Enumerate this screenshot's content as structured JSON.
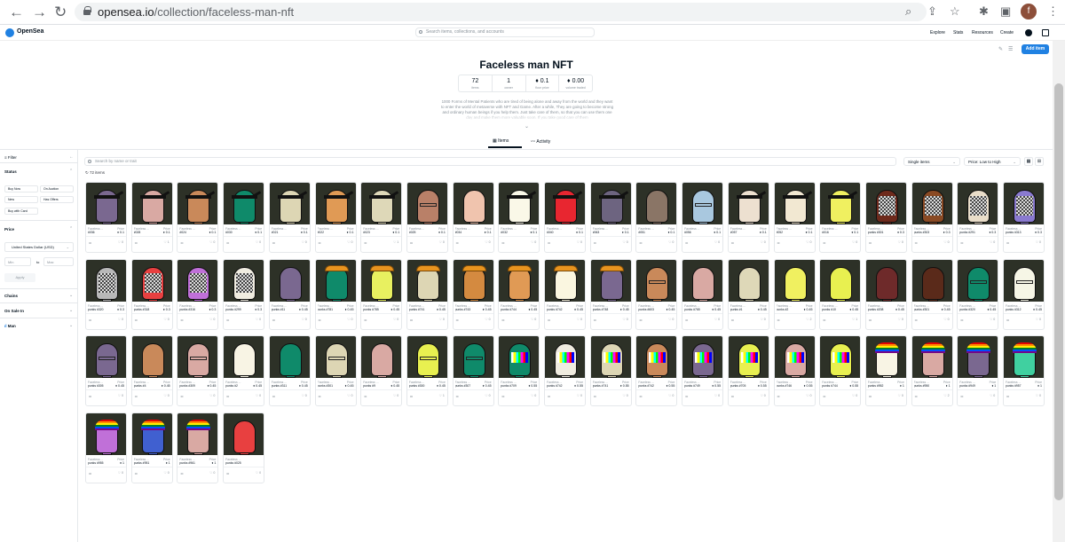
{
  "browser": {
    "url_host": "opensea.io",
    "url_path": "/collection/faceless-man-nft",
    "profile_initial": "f"
  },
  "nav": {
    "brand": "OpenSea",
    "search_placeholder": "Search items, collections, and accounts",
    "links": [
      "Explore",
      "Stats",
      "Resources",
      "Create"
    ],
    "add_item": "Add item"
  },
  "collection": {
    "title": "Faceless man NFT",
    "stats": [
      {
        "value": "72",
        "label": "items"
      },
      {
        "value": "1",
        "label": "owner"
      },
      {
        "value": "♦ 0.1",
        "label": "floor price"
      },
      {
        "value": "♦ 0.00",
        "label": "volume traded"
      }
    ],
    "description": "1000 Forms of Mental Patients who are tired of being alone and away from the world and they want to enter the world of metaverse with NFT and Game. After a while, They are going to become strong and ordinary human beings if you help them. Just take care of them, so that you can use them one day and make them more valuable soon. If you take good care of them",
    "tabs": [
      "Items",
      "Activity"
    ]
  },
  "sidebar": {
    "filter": "Filter",
    "status": "Status",
    "status_buttons": [
      "Buy Now",
      "On Auction",
      "New",
      "Has Offers",
      "Buy with Card"
    ],
    "price": "Price",
    "currency": "United States Dollar (USD)",
    "min": "Min",
    "to": "to",
    "max": "Max",
    "apply": "Apply",
    "chains": "Chains",
    "on_sale_in": "On Sale In",
    "man": "Man"
  },
  "toolbar": {
    "search_placeholder": "Search by name or trait",
    "item_type": "Single items",
    "sort": "Price: Low to High",
    "count": "72 items"
  },
  "card_labels": {
    "collection": "Faceless ...",
    "price": "Price",
    "dots": "•••"
  },
  "cards": [
    {
      "id": "#036",
      "price": "♦ 0.1",
      "fav": "0",
      "skin": "#7a6890",
      "acc": "band"
    },
    {
      "id": "#028",
      "price": "♦ 0.1",
      "fav": "1",
      "skin": "#d9a9a3",
      "acc": "band"
    },
    {
      "id": "#024",
      "price": "♦ 0.1",
      "fav": "0",
      "skin": "#c9895a",
      "acc": "band"
    },
    {
      "id": "#030",
      "price": "♦ 0.1",
      "fav": "0",
      "skin": "#0f8a6a",
      "acc": "band"
    },
    {
      "id": "#021",
      "price": "♦ 0.1",
      "fav": "0",
      "skin": "#ddd6b4",
      "acc": "band"
    },
    {
      "id": "#022",
      "price": "♦ 0.1",
      "fav": "0",
      "skin": "#e09a55",
      "acc": "band"
    },
    {
      "id": "#023",
      "price": "♦ 0.1",
      "fav": "1",
      "skin": "#ded8b8",
      "acc": "band"
    },
    {
      "id": "#025",
      "price": "♦ 0.1",
      "fav": "0",
      "skin": "#b98068",
      "acc": "glasses"
    },
    {
      "id": "#034",
      "price": "♦ 0.1",
      "fav": "0",
      "skin": "#f0c4ae",
      "acc": "none"
    },
    {
      "id": "#032",
      "price": "♦ 0.1",
      "fav": "0",
      "skin": "#faf8e8",
      "acc": "band"
    },
    {
      "id": "#040",
      "price": "♦ 0.1",
      "fav": "0",
      "skin": "#e82630",
      "acc": "band"
    },
    {
      "id": "#063",
      "price": "♦ 0.1",
      "fav": "0",
      "skin": "#6d6480",
      "acc": "band"
    },
    {
      "id": "#051",
      "price": "♦ 0.1",
      "fav": "0",
      "skin": "#8a7566",
      "acc": "none"
    },
    {
      "id": "#056",
      "price": "♦ 0.1",
      "fav": "0",
      "skin": "#a9c8df",
      "acc": "glasses"
    },
    {
      "id": "#057",
      "price": "♦ 0.1",
      "fav": "0",
      "skin": "#ede0d0",
      "acc": "band"
    },
    {
      "id": "#052",
      "price": "♦ 0.1",
      "fav": "0",
      "skin": "#f2e8d2",
      "acc": "band"
    },
    {
      "id": "#016",
      "price": "♦ 0.1",
      "fav": "0",
      "skin": "#f0f060",
      "acc": "band"
    },
    {
      "id": "punks #301",
      "price": "♦ 0.3",
      "fav": "0",
      "skin": "#6e2a1c",
      "acc": "checker"
    },
    {
      "id": "punks #303",
      "price": "♦ 0.3",
      "fav": "0",
      "skin": "#8a4a24",
      "acc": "checker"
    },
    {
      "id": "punks #291",
      "price": "♦ 0.3",
      "fav": "0",
      "skin": "#e8dcc8",
      "acc": "checker"
    },
    {
      "id": "punks #313",
      "price": "♦ 0.3",
      "fav": "0",
      "skin": "#8a7ad0",
      "acc": "checker"
    },
    {
      "id": "punks #320",
      "price": "♦ 0.3",
      "fav": "0",
      "skin": "#b8b8b8",
      "acc": "checker"
    },
    {
      "id": "punks #318",
      "price": "♦ 0.3",
      "fav": "0",
      "skin": "#e84040",
      "acc": "checker"
    },
    {
      "id": "punks #316",
      "price": "♦ 0.3",
      "fav": "0",
      "skin": "#c070d8",
      "acc": "checker"
    },
    {
      "id": "punks #299",
      "price": "♦ 0.3",
      "fav": "0",
      "skin": "#f0ece0",
      "acc": "checker"
    },
    {
      "id": "punks #11",
      "price": "♦ 0.45",
      "fav": "0",
      "skin": "#7a6890",
      "acc": "none"
    },
    {
      "id": "punks #781",
      "price": "♦ 0.45",
      "fav": "0",
      "skin": "#0f8a6a",
      "acc": "hat"
    },
    {
      "id": "punks #785",
      "price": "♦ 0.45",
      "fav": "0",
      "skin": "#e8f060",
      "acc": "hat"
    },
    {
      "id": "punks #741",
      "price": "♦ 0.45",
      "fav": "0",
      "skin": "#ddd6b4",
      "acc": "hat"
    },
    {
      "id": "punks #743",
      "price": "♦ 0.45",
      "fav": "0",
      "skin": "#d48a40",
      "acc": "hat"
    },
    {
      "id": "punks #744",
      "price": "♦ 0.45",
      "fav": "0",
      "skin": "#e09a55",
      "acc": "hat"
    },
    {
      "id": "punks #742",
      "price": "♦ 0.45",
      "fav": "0",
      "skin": "#faf6e0",
      "acc": "hat"
    },
    {
      "id": "punks #748",
      "price": "♦ 0.45",
      "fav": "0",
      "skin": "#7a6890",
      "acc": "hat"
    },
    {
      "id": "punks #603",
      "price": "♦ 0.45",
      "fav": "0",
      "skin": "#c9895a",
      "acc": "glasses"
    },
    {
      "id": "punks #765",
      "price": "♦ 0.45",
      "fav": "0",
      "skin": "#d9a9a3",
      "acc": "none"
    },
    {
      "id": "punks #1",
      "price": "♦ 0.45",
      "fav": "0",
      "skin": "#ded8b8",
      "acc": "none"
    },
    {
      "id": "punks #2",
      "price": "♦ 0.45",
      "fav": "2",
      "skin": "#f0f060",
      "acc": "none"
    },
    {
      "id": "punks #10",
      "price": "♦ 0.45",
      "fav": "1",
      "skin": "#e8f050",
      "acc": "none"
    },
    {
      "id": "punks #208",
      "price": "♦ 0.45",
      "fav": "0",
      "skin": "#6e2a2a",
      "acc": "none"
    },
    {
      "id": "punks #301",
      "price": "♦ 0.45",
      "fav": "0",
      "skin": "#5a2a1a",
      "acc": "none"
    },
    {
      "id": "punks #320",
      "price": "♦ 0.45",
      "fav": "0",
      "skin": "#0f8a6a",
      "acc": "glasses"
    },
    {
      "id": "punks #312",
      "price": "♦ 0.45",
      "fav": "0",
      "skin": "#f6f6e6",
      "acc": "glasses"
    },
    {
      "id": "punks #305",
      "price": "♦ 0.45",
      "fav": "0",
      "skin": "#7a6890",
      "acc": "glasses"
    },
    {
      "id": "punks #4",
      "price": "♦ 0.45",
      "fav": "0",
      "skin": "#c9895a",
      "acc": "none"
    },
    {
      "id": "punks #309",
      "price": "♦ 0.45",
      "fav": "0",
      "skin": "#d9a9a3",
      "acc": "glasses"
    },
    {
      "id": "punks #2",
      "price": "♦ 0.45",
      "fav": "0",
      "skin": "#f8f4e4",
      "acc": "none"
    },
    {
      "id": "punks #311",
      "price": "♦ 0.45",
      "fav": "0",
      "skin": "#0f8a6a",
      "acc": "none"
    },
    {
      "id": "punks #301",
      "price": "♦ 0.45",
      "fav": "0",
      "skin": "#ddd6b4",
      "acc": "glasses"
    },
    {
      "id": "punks #9",
      "price": "♦ 0.45",
      "fav": "0",
      "skin": "#d9a9a3",
      "acc": "none"
    },
    {
      "id": "punks #300",
      "price": "♦ 0.45",
      "fav": "1",
      "skin": "#e8f050",
      "acc": "glasses"
    },
    {
      "id": "punks #307",
      "price": "♦ 0.45",
      "fav": "0",
      "skin": "#0f8a6a",
      "acc": "glasses"
    },
    {
      "id": "punks #709",
      "price": "♦ 0.55",
      "fav": "0",
      "skin": "#0f8a6a",
      "acc": "tv"
    },
    {
      "id": "punks #742",
      "price": "♦ 0.55",
      "fav": "0",
      "skin": "#f0ece0",
      "acc": "tv"
    },
    {
      "id": "punks #741",
      "price": "♦ 0.55",
      "fav": "0",
      "skin": "#ddd6b4",
      "acc": "tv"
    },
    {
      "id": "punks #742",
      "price": "♦ 0.55",
      "fav": "0",
      "skin": "#c9895a",
      "acc": "tv"
    },
    {
      "id": "punks #749",
      "price": "♦ 0.55",
      "fav": "0",
      "skin": "#7a6890",
      "acc": "tv"
    },
    {
      "id": "punks #705",
      "price": "♦ 0.55",
      "fav": "0",
      "skin": "#e8f050",
      "acc": "tv"
    },
    {
      "id": "punks #746",
      "price": "♦ 0.55",
      "fav": "0",
      "skin": "#d9a9a3",
      "acc": "tv"
    },
    {
      "id": "punks #744",
      "price": "♦ 0.55",
      "fav": "0",
      "skin": "#e8f050",
      "acc": "tv"
    },
    {
      "id": "punks #952",
      "price": "♦ 1",
      "fav": "0",
      "skin": "#f8f4e4",
      "acc": "rainbow"
    },
    {
      "id": "punks #950",
      "price": "♦ 1",
      "fav": "2",
      "skin": "#d9a9a3",
      "acc": "rainbow"
    },
    {
      "id": "punks #949",
      "price": "♦ 1",
      "fav": "0",
      "skin": "#7a6890",
      "acc": "rainbow"
    },
    {
      "id": "punks #957",
      "price": "♦ 1",
      "fav": "0",
      "skin": "#40d0a0",
      "acc": "rainbow"
    },
    {
      "id": "punks #955",
      "price": "♦ 1",
      "fav": "0",
      "skin": "#c070d8",
      "acc": "rainbow"
    },
    {
      "id": "punks #951",
      "price": "♦ 1",
      "fav": "0",
      "skin": "#4060d0",
      "acc": "rainbow"
    },
    {
      "id": "punks #961",
      "price": "♦ 1",
      "fav": "0",
      "skin": "#d9a9a3",
      "acc": "rainbow"
    },
    {
      "id": "punks #025",
      "price": "",
      "fav": "0",
      "skin": "#e84040",
      "acc": "none"
    }
  ]
}
